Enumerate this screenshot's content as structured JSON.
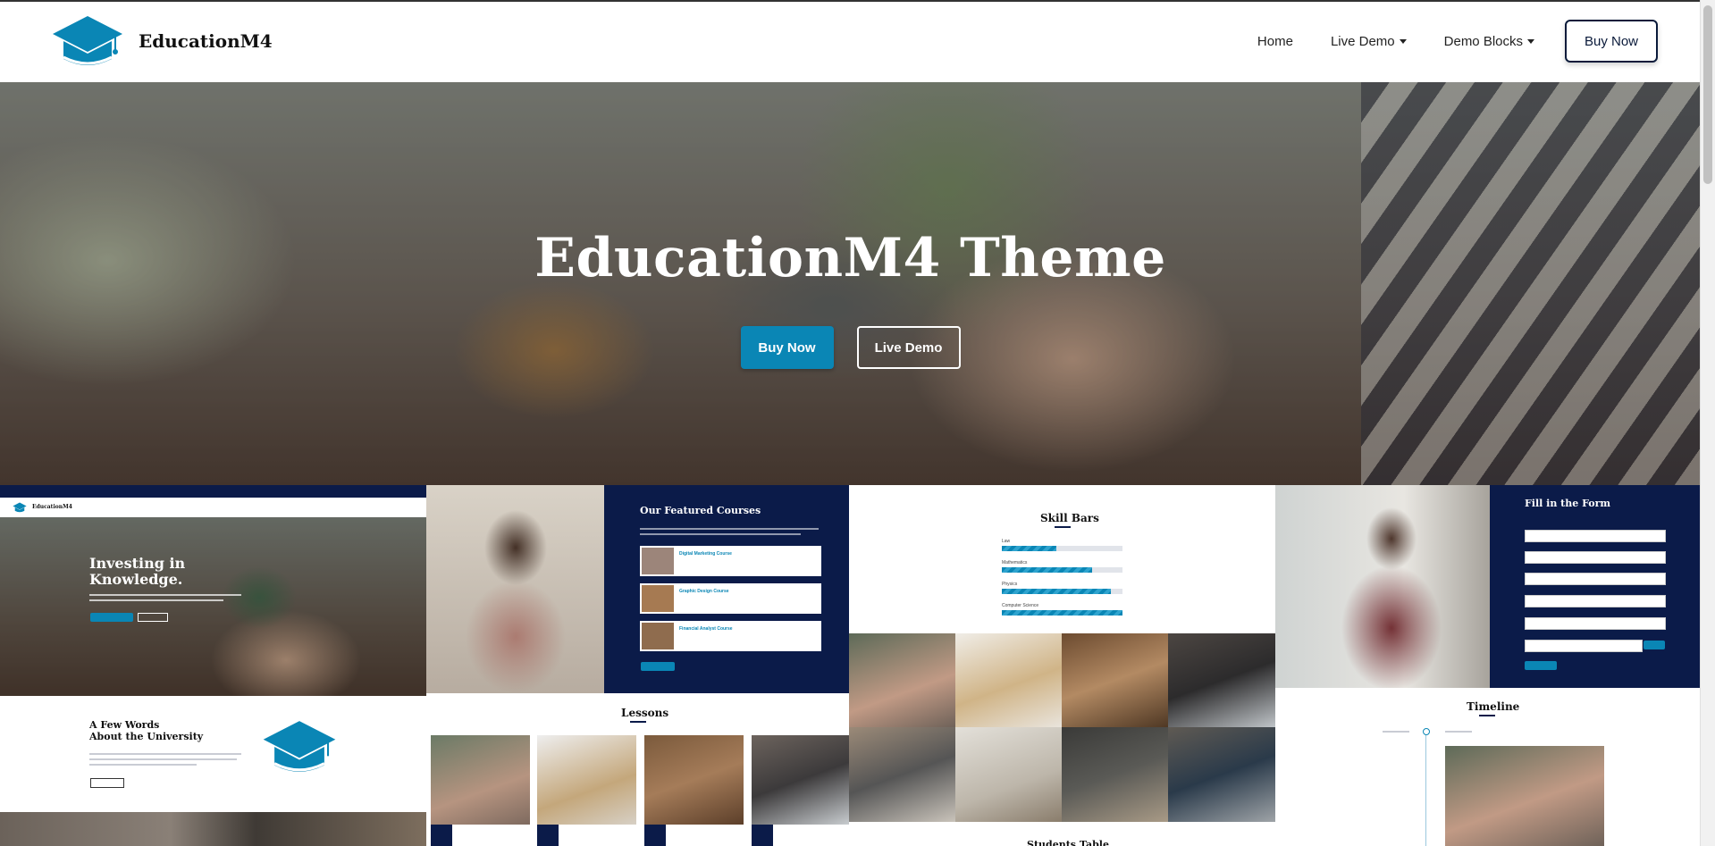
{
  "brand": {
    "name": "EducationM4",
    "accent": "#0a86b5",
    "navy": "#0b1b49"
  },
  "nav": {
    "items": [
      {
        "label": "Home",
        "dropdown": false
      },
      {
        "label": "Live Demo",
        "dropdown": true
      },
      {
        "label": "Demo Blocks",
        "dropdown": true
      }
    ],
    "cta_label": "Buy Now"
  },
  "hero": {
    "title": "EducationM4 Theme",
    "primary_button": "Buy Now",
    "secondary_button": "Live Demo"
  },
  "previews": {
    "home": {
      "title_line1": "Investing in",
      "title_line2": "Knowledge.",
      "logo_text": "EducationM4",
      "about_title_line1": "A Few Words",
      "about_title_line2": "About the University"
    },
    "courses": {
      "title": "Our Featured Courses",
      "items": [
        "Digital Marketing Course",
        "Graphic Design Course",
        "Financial Analyst Course"
      ]
    },
    "lessons": {
      "title": "Lessons"
    },
    "skills": {
      "title": "Skill Bars",
      "bars": [
        {
          "label": "Law",
          "value": 45
        },
        {
          "label": "Mathematics",
          "value": 75
        },
        {
          "label": "Physics",
          "value": 90
        },
        {
          "label": "Computer Science",
          "value": 100
        }
      ],
      "table_title": "Students Table"
    },
    "form": {
      "title": "Fill in the Form"
    },
    "timeline": {
      "title": "Timeline"
    }
  },
  "icons": [
    "graduation-cap-icon",
    "caret-down-icon"
  ]
}
